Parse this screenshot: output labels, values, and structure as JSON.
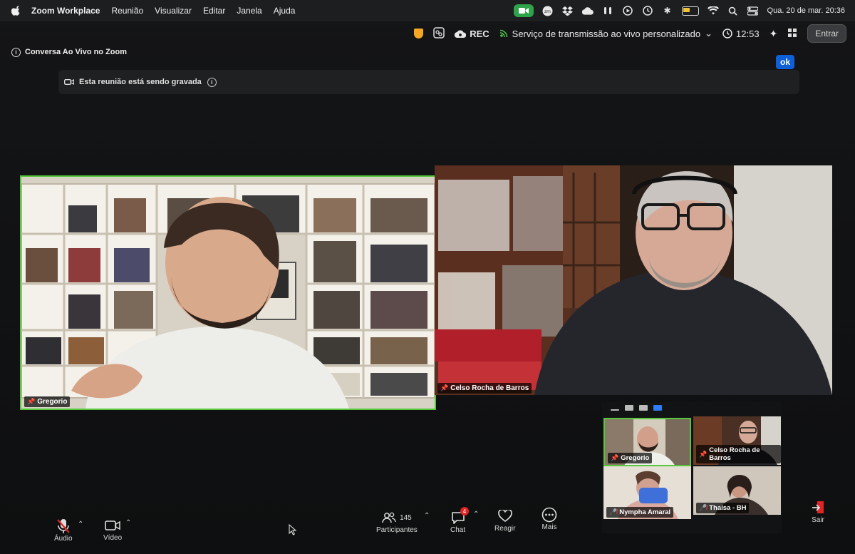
{
  "menubar": {
    "app_name": "Zoom Workplace",
    "menu_items": [
      "Reunião",
      "Visualizar",
      "Editar",
      "Janela",
      "Ajuda"
    ],
    "clock": "Qua. 20 de mar. 20:36"
  },
  "toolbar": {
    "rec_label": "REC",
    "stream_label": "Serviço de transmissão ao vivo personalizado",
    "timer": "12:53",
    "enter_label": "Entrar"
  },
  "info_bar": {
    "text": "Conversa Ao Vivo no Zoom"
  },
  "recording_banner": {
    "text": "Esta reunião está sendo gravada",
    "ok_label": "ok"
  },
  "speakers": [
    {
      "name": "Gregorio"
    },
    {
      "name": "Celso Rocha de Barros"
    }
  ],
  "gallery": [
    {
      "name": "Gregorio"
    },
    {
      "name": "Celso Rocha de Barros"
    },
    {
      "name": "Nympha Amaral"
    },
    {
      "name": "Thaísa - BH"
    }
  ],
  "bottom_bar": {
    "audio_label": "Áudio",
    "video_label": "Vídeo",
    "participants_label": "Participantes",
    "participants_count": "145",
    "chat_label": "Chat",
    "chat_badge": "4",
    "react_label": "Reagir",
    "more_label": "Mais",
    "leave_label": "Sair"
  },
  "colors": {
    "active_speaker": "#55c93a",
    "ok_button": "#0e5fd8",
    "muted": "#e02424",
    "shield": "#f5a623"
  }
}
